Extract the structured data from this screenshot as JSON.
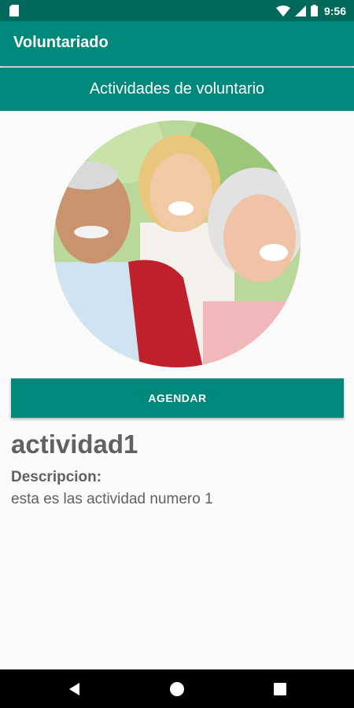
{
  "status_bar": {
    "time": "9:56",
    "icons": [
      "sd-card-icon",
      "wifi-icon",
      "signal-icon",
      "battery-icon"
    ]
  },
  "app_bar": {
    "title": "Voluntariado"
  },
  "section_header": {
    "title": "Actividades de voluntario"
  },
  "image": {
    "description_icon": "volunteer-photo"
  },
  "buttons": {
    "agendar_label": "AGENDAR"
  },
  "activity": {
    "name": "actividad1",
    "description_label": "Descripcion:",
    "description": "esta es las actividad numero 1"
  },
  "colors": {
    "primary_dark": "#00695c",
    "primary": "#00897b",
    "text": "#616161",
    "background": "#fafafa"
  },
  "nav_bar": {
    "icons": [
      "back-icon",
      "home-icon",
      "recents-icon"
    ]
  }
}
